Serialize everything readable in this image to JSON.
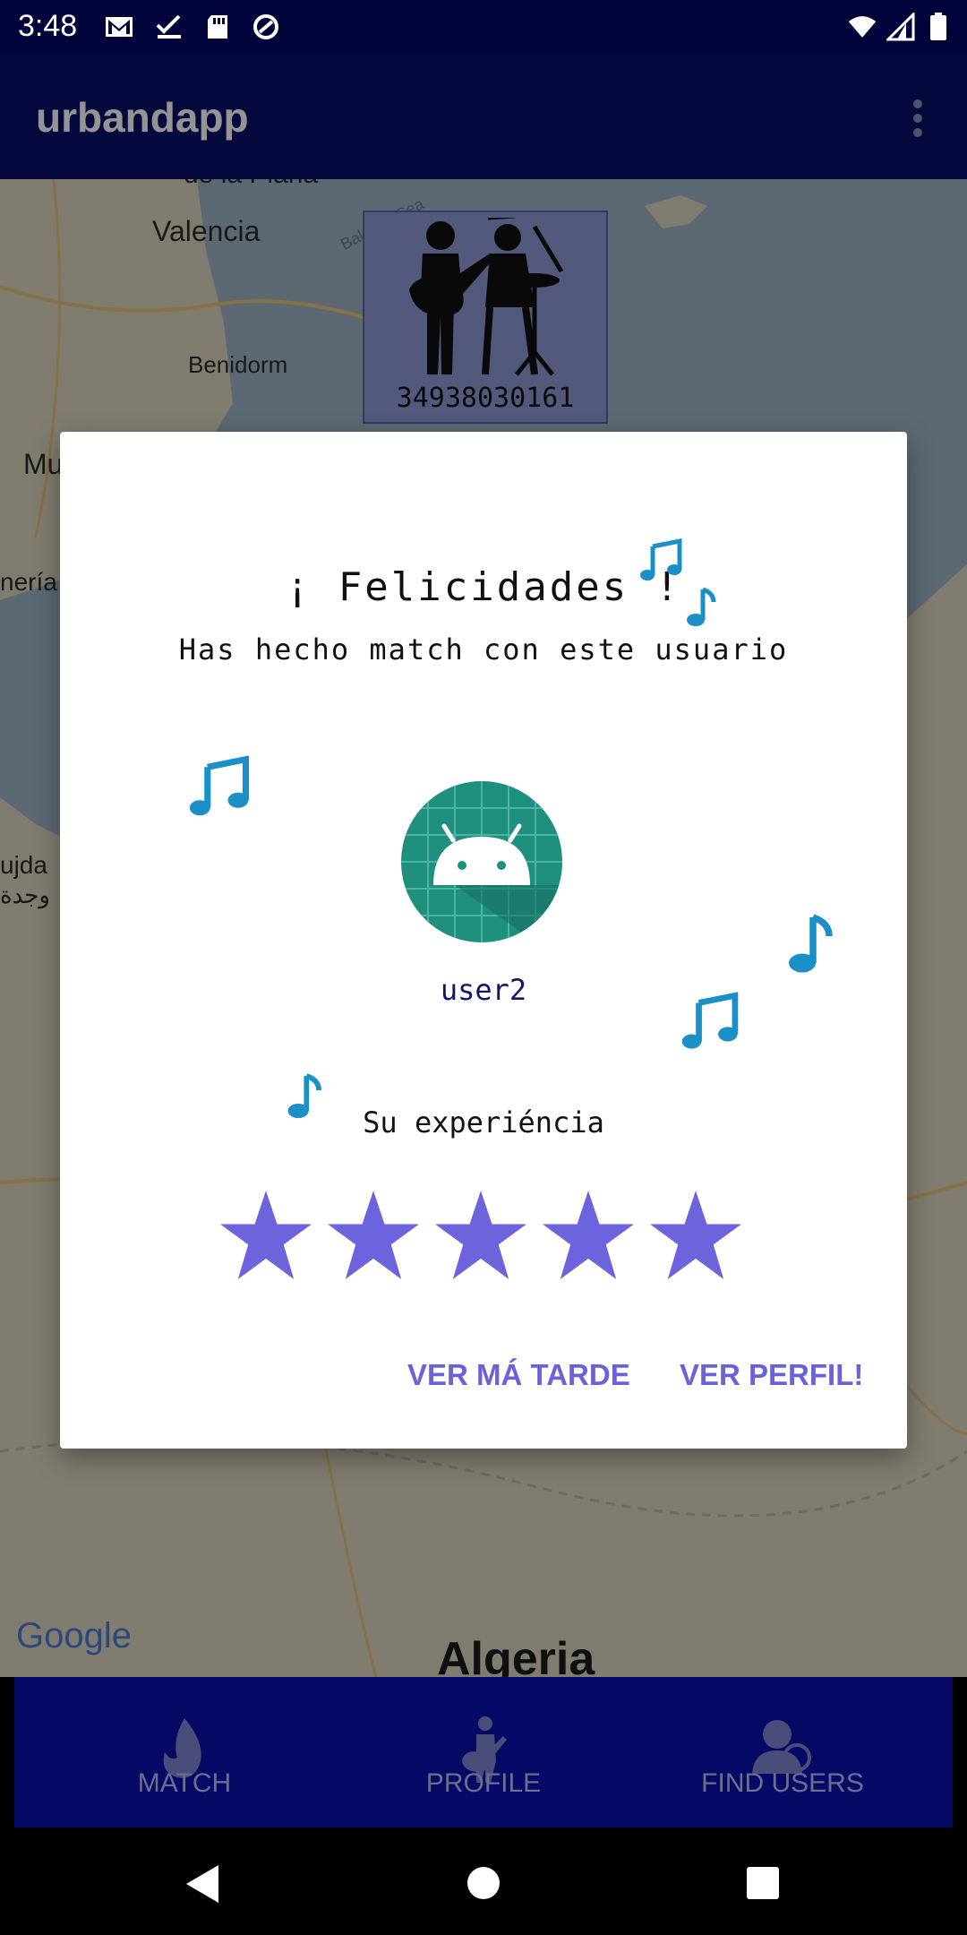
{
  "status_bar": {
    "time": "3:48",
    "icons_left": [
      "gmail-icon",
      "check-icon",
      "sd-card-icon",
      "sync-icon"
    ],
    "icons_right": [
      "wifi-icon",
      "signal-icon",
      "battery-icon"
    ]
  },
  "app_bar": {
    "title": "urbandapp",
    "overflow_icon": "more-vert-icon"
  },
  "map": {
    "labels": {
      "plana": "de la Plana",
      "valencia": "Valencia",
      "balearic": "Balearic Sea",
      "benidorm": "Benidorm",
      "mu": "Mu",
      "neria": "nería",
      "ujda": "ujda",
      "ujda_ar": "وجدة",
      "algeria": "Algeria",
      "google": "Google"
    },
    "marker_phone": "34938030161"
  },
  "dialog": {
    "title": "¡ Felicidades !",
    "subtitle": "Has hecho match con este usuario",
    "username": "user2",
    "experience_label": "Su experiéncia",
    "rating": 5,
    "rating_max": 5,
    "buttons": {
      "later": "VER MÁ TARDE",
      "profile": "VER PERFIL!"
    }
  },
  "bottom_nav": {
    "items": [
      {
        "label": "MATCH",
        "icon": "flame-icon"
      },
      {
        "label": "PROFILE",
        "icon": "guitarist-icon"
      },
      {
        "label": "FIND USERS",
        "icon": "user-search-icon"
      }
    ]
  },
  "colors": {
    "accent": "#6a62d8",
    "star": "#6c63dd",
    "note": "#1b8fc7",
    "app_bar": "#0a0f6a",
    "bottom_nav": "#060a66"
  }
}
